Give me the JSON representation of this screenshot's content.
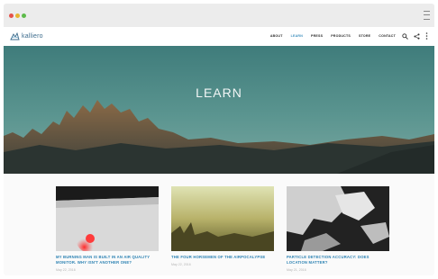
{
  "nav": {
    "logo_text": "kalliero",
    "links": [
      {
        "label": "ABOUT",
        "active": false
      },
      {
        "label": "LEARN",
        "active": true
      },
      {
        "label": "PRESS",
        "active": false
      },
      {
        "label": "PRODUCTS",
        "active": false
      },
      {
        "label": "STORE",
        "active": false
      },
      {
        "label": "CONTACT",
        "active": false
      }
    ],
    "icons": [
      "search-icon",
      "share-icon",
      "more-vertical-icon"
    ]
  },
  "hero": {
    "title": "LEARN"
  },
  "cards": [
    {
      "title": "MY BURNING MAN IS BUILT IN AN AIR QUALITY MONITOR. WHY ISN'T ANOTHER ONE?",
      "date": "May 22, 2016",
      "meta": ""
    },
    {
      "title": "THE FOUR HORSEMEN OF THE AIRPOCALYPSE",
      "date": "May 22, 2016",
      "meta": ""
    },
    {
      "title": "PARTICLE DETECTION ACCURACY: DOES LOCATION MATTER?",
      "date": "May 21, 2016",
      "meta": ""
    }
  ],
  "colors": {
    "accent": "#3d8fbd",
    "card_title": "#2c82b3",
    "hero_sky": "#4f8a88"
  }
}
